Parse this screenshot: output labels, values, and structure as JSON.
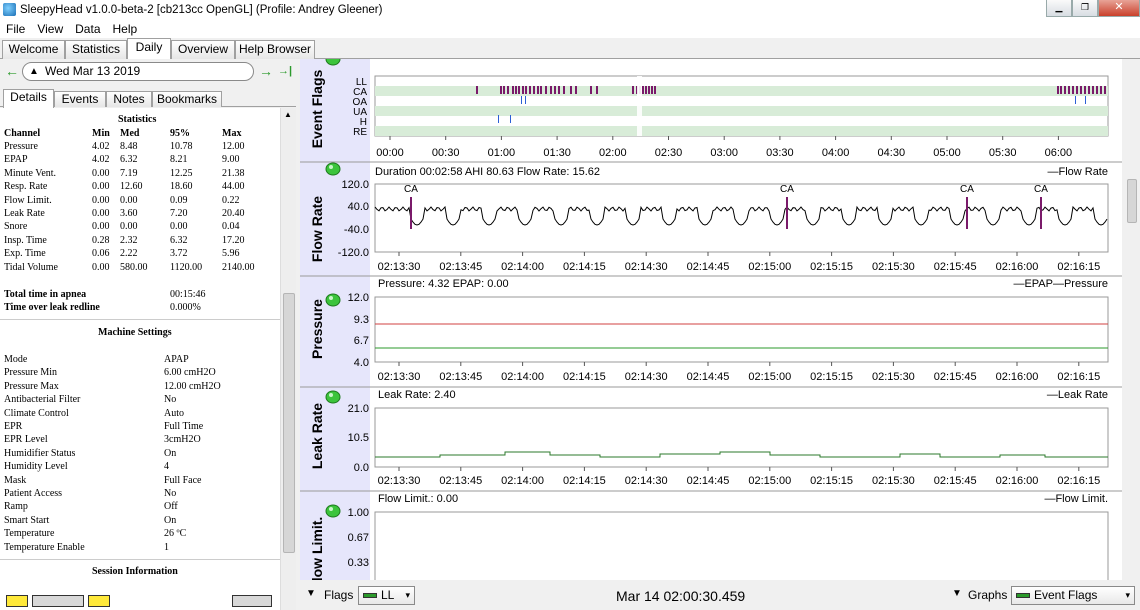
{
  "window": {
    "title": "SleepyHead v1.0.0-beta-2 [cb213cc OpenGL] (Profile: Andrey Gleener)",
    "minimize": "▁",
    "restore": "❐",
    "close": "✕"
  },
  "menu": [
    "File",
    "View",
    "Data",
    "Help"
  ],
  "tabs": [
    "Welcome",
    "Statistics",
    "Daily",
    "Overview",
    "Help Browser"
  ],
  "active_tab": "Daily",
  "date_nav": {
    "prev_icon": "arrow-left-icon",
    "date": "Wed Mar 13 2019",
    "next_icon": "arrow-right-icon",
    "last_icon": "arrow-last-icon",
    "prev": "←",
    "next": "→",
    "last": "→|",
    "tri": "▲"
  },
  "subtabs": [
    "Details",
    "Events",
    "Notes",
    "Bookmarks"
  ],
  "statistics": {
    "title": "Statistics",
    "headers": [
      "Channel",
      "Min",
      "Med",
      "95%",
      "Max"
    ],
    "rows": [
      [
        "Pressure",
        "4.02",
        "8.48",
        "10.78",
        "12.00"
      ],
      [
        "EPAP",
        "4.02",
        "6.32",
        "8.21",
        "9.00"
      ],
      [
        "Minute Vent.",
        "0.00",
        "7.19",
        "12.25",
        "21.38"
      ],
      [
        "Resp. Rate",
        "0.00",
        "12.60",
        "18.60",
        "44.00"
      ],
      [
        "Flow Limit.",
        "0.00",
        "0.00",
        "0.09",
        "0.22"
      ],
      [
        "Leak Rate",
        "0.00",
        "3.60",
        "7.20",
        "20.40"
      ],
      [
        "Snore",
        "0.00",
        "0.00",
        "0.00",
        "0.04"
      ],
      [
        "Insp. Time",
        "0.28",
        "2.32",
        "6.32",
        "17.20"
      ],
      [
        "Exp. Time",
        "0.06",
        "2.22",
        "3.72",
        "5.96"
      ],
      [
        "Tidal Volume",
        "0.00",
        "580.00",
        "1120.00",
        "2140.00"
      ]
    ],
    "totals": [
      [
        "Total time in apnea",
        "00:15:46"
      ],
      [
        "Time over leak redline",
        "0.000%"
      ]
    ]
  },
  "machine_settings": {
    "title": "Machine Settings",
    "rows": [
      [
        "Mode",
        "APAP"
      ],
      [
        "Pressure Min",
        "6.00 cmH2O"
      ],
      [
        "Pressure Max",
        "12.00 cmH2O"
      ],
      [
        "Antibacterial Filter",
        "No"
      ],
      [
        "Climate Control",
        "Auto"
      ],
      [
        "EPR",
        "Full Time"
      ],
      [
        "EPR Level",
        "3cmH2O"
      ],
      [
        "Humidifier Status",
        "On"
      ],
      [
        "Humidity Level",
        "4"
      ],
      [
        "Mask",
        "Full Face"
      ],
      [
        "Patient Access",
        "No"
      ],
      [
        "Ramp",
        "Off"
      ],
      [
        "Smart Start",
        "On"
      ],
      [
        "Temperature",
        "26 ºC"
      ],
      [
        "Temperature Enable",
        "1"
      ]
    ]
  },
  "session_info": {
    "title": "Session Information"
  },
  "charts": {
    "event_flags": {
      "label": "Event Flags",
      "rows": [
        "LL",
        "CA",
        "OA",
        "UA",
        "H",
        "RE"
      ],
      "xticks": [
        "00:00",
        "00:30",
        "01:00",
        "01:30",
        "02:00",
        "02:30",
        "03:00",
        "03:30",
        "04:00",
        "04:30",
        "05:00",
        "05:30",
        "06:00"
      ]
    },
    "flow_rate": {
      "label": "Flow Rate",
      "info": "Duration 00:02:58 AHI 80.63 Flow Rate: 15.62",
      "legend": "Flow Rate",
      "yticks": [
        "120.0",
        "40.0",
        "-40.0",
        "-120.0"
      ],
      "annotations": [
        "CA",
        "CA",
        "CA",
        "CA"
      ],
      "xticks": [
        "02:13:30",
        "02:13:45",
        "02:14:00",
        "02:14:15",
        "02:14:30",
        "02:14:45",
        "02:15:00",
        "02:15:15",
        "02:15:30",
        "02:15:45",
        "02:16:00",
        "02:16:15"
      ]
    },
    "pressure": {
      "label": "Pressure",
      "info": "Pressure: 4.32 EPAP: 0.00",
      "legend": "EPAP—Pressure",
      "yticks": [
        "12.0",
        "9.3",
        "6.7",
        "4.0"
      ],
      "xticks": [
        "02:13:30",
        "02:13:45",
        "02:14:00",
        "02:14:15",
        "02:14:30",
        "02:14:45",
        "02:15:00",
        "02:15:15",
        "02:15:30",
        "02:15:45",
        "02:16:00",
        "02:16:15"
      ]
    },
    "leak_rate": {
      "label": "Leak Rate",
      "info": "Leak Rate: 2.40",
      "legend": "Leak Rate",
      "yticks": [
        "21.0",
        "10.5",
        "0.0"
      ],
      "xticks": [
        "02:13:30",
        "02:13:45",
        "02:14:00",
        "02:14:15",
        "02:14:30",
        "02:14:45",
        "02:15:00",
        "02:15:15",
        "02:15:30",
        "02:15:45",
        "02:16:00",
        "02:16:15"
      ]
    },
    "flow_limit": {
      "label": "low Limit.",
      "info": "Flow Limit.: 0.00",
      "legend": "Flow Limit.",
      "yticks": [
        "1.00",
        "0.67",
        "0.33"
      ]
    }
  },
  "bottom": {
    "flags_label": "Flags",
    "flags_value": "LL",
    "timestamp": "Mar 14 02:00:30.459",
    "graphs_label": "Graphs",
    "graphs_value": "Event Flags",
    "tri": "▼",
    "dd": "▾"
  },
  "colors": {
    "series": "#000000",
    "pressure": "#d04040",
    "epap": "#2b9a2b",
    "leak": "#2b7a2b",
    "flag_ca": "#7a1a6a",
    "flag_oa": "#2b5fd6",
    "band": "#d8ecd8",
    "gutter": "#e6e6fb"
  }
}
